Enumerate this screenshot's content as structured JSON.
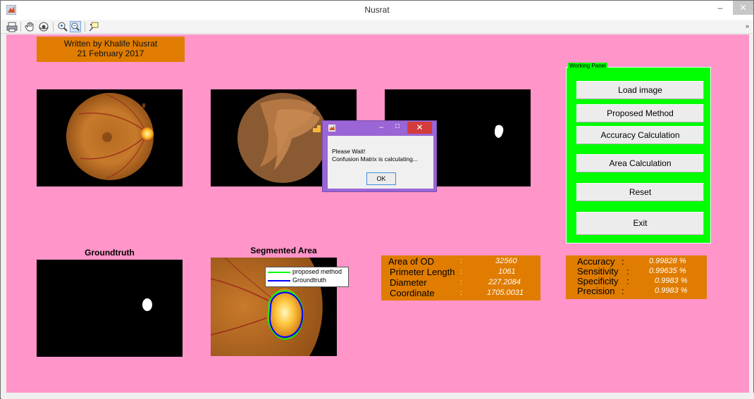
{
  "window": {
    "title": "Nusrat",
    "controls": [
      "–",
      "□",
      "✕"
    ]
  },
  "toolbar": {
    "icons": [
      "print-icon",
      "pan-hand-icon",
      "rotate-3d-icon",
      "zoom-in-icon",
      "zoom-out-icon",
      "data-cursor-icon"
    ],
    "overflow": "»"
  },
  "author": {
    "line1": "Written by Khalife Nusrat",
    "line2": "21 February 2017"
  },
  "axes": {
    "groundtruth_title": "Groundtruth",
    "segmented_title": "Segmented Area",
    "legend": [
      {
        "label": "proposed method",
        "color": "#00ff00"
      },
      {
        "label": "Groundtruth",
        "color": "#0000ff"
      }
    ]
  },
  "panel": {
    "label": "Working Panel",
    "buttons": [
      "Load image",
      "Proposed Method",
      "Accuracy Calculation",
      "Area Calculation",
      "Reset",
      "Exit"
    ]
  },
  "measurements": [
    {
      "label": "Area  of OD",
      "sep": ":",
      "value": "32560"
    },
    {
      "label": "Primeter Length",
      "sep": ":",
      "value": "1061"
    },
    {
      "label": "Diameter",
      "sep": ":",
      "value": "227.2084"
    },
    {
      "label": "Coordinate",
      "sep": ":",
      "value": "1705.0031"
    }
  ],
  "metrics": [
    {
      "label": "Accuracy",
      "sep": ":",
      "value": "0.99828 %"
    },
    {
      "label": "Sensitivity",
      "sep": ":",
      "value": "0.99635 %"
    },
    {
      "label": "Specificity",
      "sep": ":",
      "value": "0.9983 %"
    },
    {
      "label": "Precision",
      "sep": ":",
      "value": "0.9983 %"
    }
  ],
  "dialog": {
    "line1": "Please Wait!",
    "line2": "Confusion Matrix is calculating...",
    "ok_label": "OK",
    "controls": [
      "–",
      "□",
      "✕"
    ]
  },
  "colors": {
    "background": "#ff95c8",
    "panel": "#00ff00",
    "info_box": "#e07c00",
    "dialog_frame": "#9a66d6"
  }
}
